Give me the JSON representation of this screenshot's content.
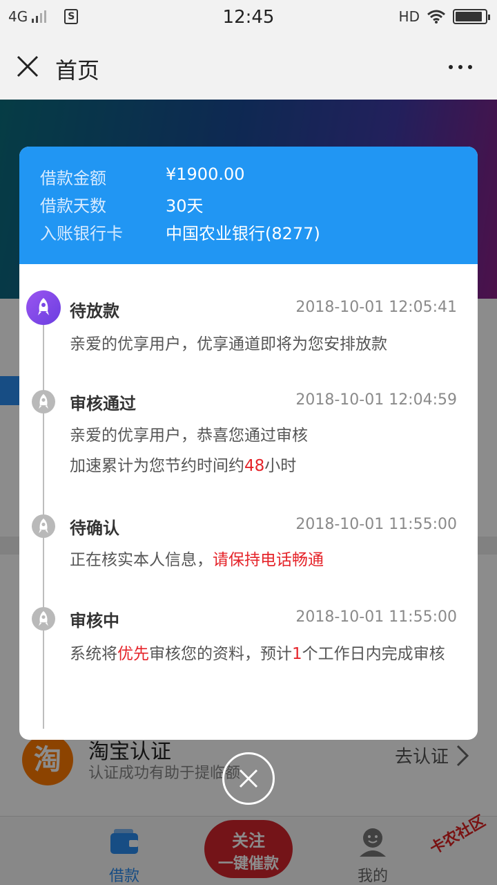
{
  "status_bar": {
    "network": "4G",
    "sim_icon": "sim-card-icon",
    "time": "12:45",
    "hd": "HD",
    "wifi_icon": "wifi-icon",
    "battery_icon": "battery-icon",
    "battery_level": 0.9
  },
  "navbar": {
    "close_icon": "close-icon",
    "title": "首页",
    "more_icon": "more-dots-icon"
  },
  "modal": {
    "loan_info": [
      {
        "label": "借款金额",
        "value": "¥1900.00"
      },
      {
        "label": "借款天数",
        "value": "30天"
      },
      {
        "label": "入账银行卡",
        "value": "中国农业银行(8277)"
      }
    ],
    "timeline": [
      {
        "status": "待放款",
        "time": "2018-10-01 12:05:41",
        "desc_line1": "亲爱的优享用户，优享通道即将为您安排放款",
        "active": true
      },
      {
        "status": "审核通过",
        "time": "2018-10-01 12:04:59",
        "desc_line1": "亲爱的优享用户，恭喜您通过审核",
        "desc_line2_a": "加速累计为您节约时间约",
        "desc_line2_b": "48",
        "desc_line2_c": "小时"
      },
      {
        "status": "待确认",
        "time": "2018-10-01 11:55:00",
        "desc_a": "正在核实本人信息，",
        "desc_b": "请保持电话畅通"
      },
      {
        "status": "审核中",
        "time": "2018-10-01 11:55:00",
        "desc_a": "系统将",
        "desc_b": "优先",
        "desc_c": "审核您的资料，预计",
        "desc_d": "1",
        "desc_e": "个工作日内完成审核"
      }
    ],
    "close_icon": "close-circle-icon",
    "accent_color": "#2196f3",
    "highlight_color": "#e5242a"
  },
  "background": {
    "taobao": {
      "icon_text": "淘",
      "title": "淘宝认证",
      "subtitle": "认证成功有助于提临额",
      "action": "去认证"
    }
  },
  "tabbar": {
    "loan_label": "借款",
    "mine_label": "我的",
    "promo_line1": "关注",
    "promo_line2": "一键催款"
  },
  "watermark": "卡农社区"
}
